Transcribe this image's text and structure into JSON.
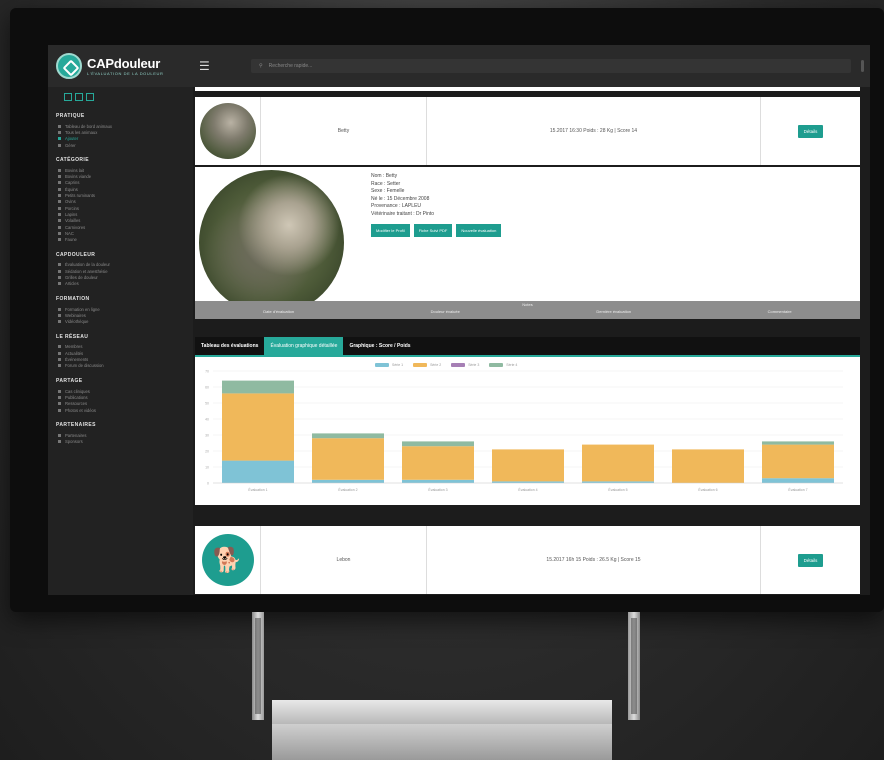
{
  "app": {
    "brand_name": "CAPdouleur",
    "brand_tagline": "L'ÉVALUATION DE LA DOULEUR",
    "menu_icon": "hamburger-icon",
    "search_placeholder": "Recherche rapide..."
  },
  "sidebar": {
    "sections": [
      {
        "title": "PRATIQUE",
        "items": [
          "Tableau de bord animaux",
          "Tous les animaux",
          "Ajouter",
          "Gérer"
        ],
        "active_index": 2
      },
      {
        "title": "CATÉGORIE",
        "items": [
          "Bovins lait",
          "Bovins viande",
          "Caprins",
          "Équins",
          "Petits ruminants",
          "Ovins",
          "Porcins",
          "Lapins",
          "Volailles",
          "Carnivores",
          "NAC",
          "Faune"
        ]
      },
      {
        "title": "CAPDOULEUR",
        "items": [
          "Évaluation de la douleur",
          "Sédation et anesthésie",
          "Grilles de douleur",
          "Articles"
        ]
      },
      {
        "title": "FORMATION",
        "items": [
          "Formation en ligne",
          "Webinaires",
          "Vidéothèque"
        ]
      },
      {
        "title": "LE RÉSEAU",
        "items": [
          "Membres",
          "Actualités",
          "Événements",
          "Forum de discussion"
        ]
      },
      {
        "title": "PARTAGE",
        "items": [
          "Cas cliniques",
          "Publications",
          "Ressources",
          "Photos et vidéos"
        ]
      },
      {
        "title": "PARTENAIRES",
        "items": [
          "Partenaires",
          "Sponsors"
        ]
      }
    ]
  },
  "rows": [
    {
      "name": "Betty",
      "summary": "15.2017 16:30 Poids : 28 Kg | Score 14",
      "action": "Détails"
    },
    {
      "name": "Lebon",
      "summary": "15.2017 16h 15 Poids : 26.5 Kg | Score 15",
      "action": "Détails"
    }
  ],
  "detail": {
    "lines": [
      "Nom : Betty",
      "Race : Setter",
      "Sexe : Femelle",
      "Né le : 15 Décembre 2008",
      "Provenance : LAPLEU",
      "Vétérinaire traitant : Dr Pinto"
    ],
    "buttons": [
      "Modifier le Profil",
      "Fiche Suivi PDF",
      "Nouvelle évaluation"
    ],
    "footer_label": "Notes",
    "footer_cols": [
      "Date d'évaluation",
      "Douleur évaluée",
      "Dernière évaluation",
      "Commentaire"
    ]
  },
  "tabs": [
    {
      "label": "Tableau des évaluations",
      "active": false
    },
    {
      "label": "Évaluation graphique détaillée",
      "active": true
    },
    {
      "label": "Graphique : Score / Poids",
      "active": false
    }
  ],
  "chart_data": {
    "type": "bar",
    "stacked": true,
    "categories": [
      "Évaluation 1",
      "Évaluation 2",
      "Évaluation 3",
      "Évaluation 4",
      "Évaluation 5",
      "Évaluation 6",
      "Évaluation 7"
    ],
    "series": [
      {
        "name": "Série 1",
        "color": "#7fc3d6",
        "values": [
          14,
          2,
          2,
          1,
          1,
          0,
          3
        ]
      },
      {
        "name": "Série 2",
        "color": "#f0b85a",
        "values": [
          42,
          26,
          21,
          20,
          23,
          21,
          21
        ]
      },
      {
        "name": "Série 3",
        "color": "#a67fb5",
        "values": [
          0,
          0,
          0,
          0,
          0,
          0,
          0
        ]
      },
      {
        "name": "Série 4",
        "color": "#8fbaa1",
        "values": [
          8,
          3,
          3,
          0,
          0,
          0,
          2
        ]
      }
    ],
    "ylim": [
      0,
      70
    ],
    "yticks": [
      0,
      10,
      20,
      30,
      40,
      50,
      60,
      70
    ],
    "grid": true,
    "legend": "top-center"
  }
}
